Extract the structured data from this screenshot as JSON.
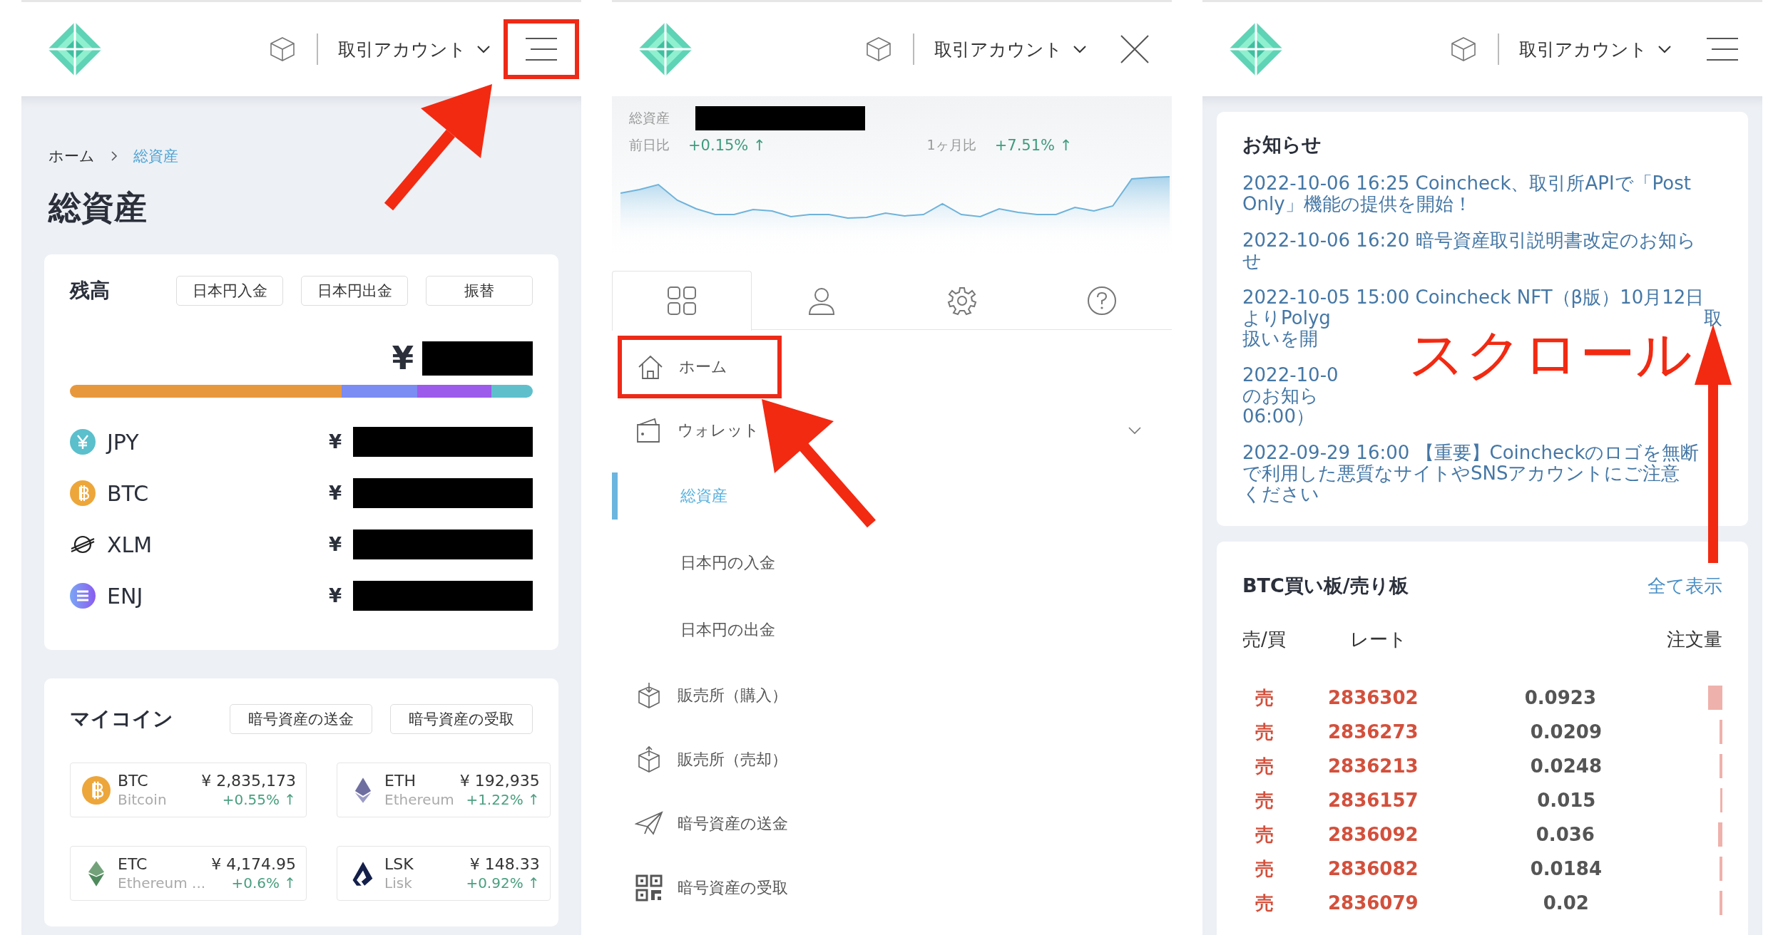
{
  "assets_screen": {
    "header": {
      "account_label": "取引アカウント",
      "highlighted": true
    },
    "breadcrumb": [
      {
        "label": "ホーム",
        "selected": false
      },
      {
        "label": "総資産",
        "selected": true
      }
    ],
    "title": "総資産",
    "balance": {
      "title": "残高",
      "buttons": [
        "日本円入金",
        "日本円出金",
        "振替"
      ],
      "total_sign": "¥",
      "allocation": [
        {
          "color": "#e8983c"
        },
        {
          "color": "#7b8cf2"
        },
        {
          "color": "#9c5bea"
        },
        {
          "color": "#5fc0cc"
        }
      ],
      "rows": [
        {
          "symbol": "JPY",
          "sign": "¥"
        },
        {
          "symbol": "BTC",
          "sign": "¥"
        },
        {
          "symbol": "XLM",
          "sign": "¥"
        },
        {
          "symbol": "ENJ",
          "sign": "¥"
        }
      ]
    },
    "my_coins": {
      "title": "マイコイン",
      "buttons": [
        "暗号資産の送金",
        "暗号資産の受取"
      ],
      "coins": [
        {
          "symbol": "BTC",
          "name": "Bitcoin",
          "price": "¥ 2,835,173",
          "change": "+0.55% ↑"
        },
        {
          "symbol": "ETH",
          "name": "Ethereum",
          "price": "¥ 192,935",
          "change": "+1.22% ↑"
        },
        {
          "symbol": "ETC",
          "name": "Ethereum ...",
          "price": "¥ 4,174.95",
          "change": "+0.6% ↑"
        },
        {
          "symbol": "LSK",
          "name": "Lisk",
          "price": "¥ 148.33",
          "change": "+0.92% ↑"
        }
      ]
    }
  },
  "menu_screen": {
    "header": {
      "account_label": "取引アカウント",
      "highlighted": false
    },
    "summary": {
      "label": "総資産",
      "day_label": "前日比",
      "day_change": "+0.15% ↑",
      "month_label": "1ヶ月比",
      "month_change": "+7.51% ↑"
    },
    "tabs": [
      {
        "selected": true
      },
      {
        "selected": false
      },
      {
        "selected": false
      },
      {
        "selected": false
      }
    ],
    "menu": [
      {
        "label": "ホーム",
        "highlighted": true,
        "selected": false
      },
      {
        "label": "ウォレット",
        "highlighted": false,
        "selected": false,
        "expanded": true,
        "children": [
          {
            "label": "総資産",
            "selected": true
          },
          {
            "label": "日本円の入金",
            "selected": false
          },
          {
            "label": "日本円の出金",
            "selected": false
          }
        ]
      },
      {
        "label": "販売所（購入）",
        "highlighted": false,
        "selected": false
      },
      {
        "label": "販売所（売却）",
        "highlighted": false,
        "selected": false
      },
      {
        "label": "暗号資産の送金",
        "highlighted": false,
        "selected": false
      },
      {
        "label": "暗号資産の受取",
        "highlighted": false,
        "selected": false
      }
    ]
  },
  "notices_screen": {
    "header": {
      "account_label": "取引アカウント",
      "highlighted": false
    },
    "notices": {
      "title": "お知らせ",
      "items": [
        {
          "lines": [
            {
              "text": "2022-10-06 16:25 Coincheck、取引所APIで「Post"
            },
            {
              "text": "Only」機能の提供を開始！"
            }
          ]
        },
        {
          "lines": [
            {
              "text": "2022-10-06 16:20 暗号資産取引説明書改定のお知ら"
            },
            {
              "text": "せ"
            }
          ]
        },
        {
          "lines": [
            {
              "text": "2022-10-05 15:00 Coincheck NFT（β版）10月12日"
            },
            {
              "text": "よりPolyg",
              "end": "取"
            },
            {
              "text": "扱いを開"
            }
          ]
        },
        {
          "lines": [
            {
              "text": "2022-10-0"
            },
            {
              "text": "のお知ら"
            },
            {
              "text": "06:00）"
            }
          ]
        },
        {
          "lines": [
            {
              "text": "2022-09-29 16:00 【重要】Coincheckのロゴを無断"
            },
            {
              "text": "で利用した悪質なサイトやSNSアカウントにご注意"
            },
            {
              "text": "ください"
            }
          ]
        }
      ]
    },
    "order_book": {
      "title": "BTC買い板/売り板",
      "link": "全て表示",
      "columns": [
        "売/買",
        "レート",
        "注文量"
      ],
      "rows": [
        {
          "side": "売",
          "rate": "2836302",
          "amount": "0.0923"
        },
        {
          "side": "売",
          "rate": "2836273",
          "amount": "0.0209"
        },
        {
          "side": "売",
          "rate": "2836213",
          "amount": "0.0248"
        },
        {
          "side": "売",
          "rate": "2836157",
          "amount": "0.015"
        },
        {
          "side": "売",
          "rate": "2836092",
          "amount": "0.036"
        },
        {
          "side": "売",
          "rate": "2836082",
          "amount": "0.0184"
        },
        {
          "side": "売",
          "rate": "2836079",
          "amount": "0.02"
        }
      ]
    }
  },
  "annotation": {
    "scroll_label": "スクロール"
  }
}
